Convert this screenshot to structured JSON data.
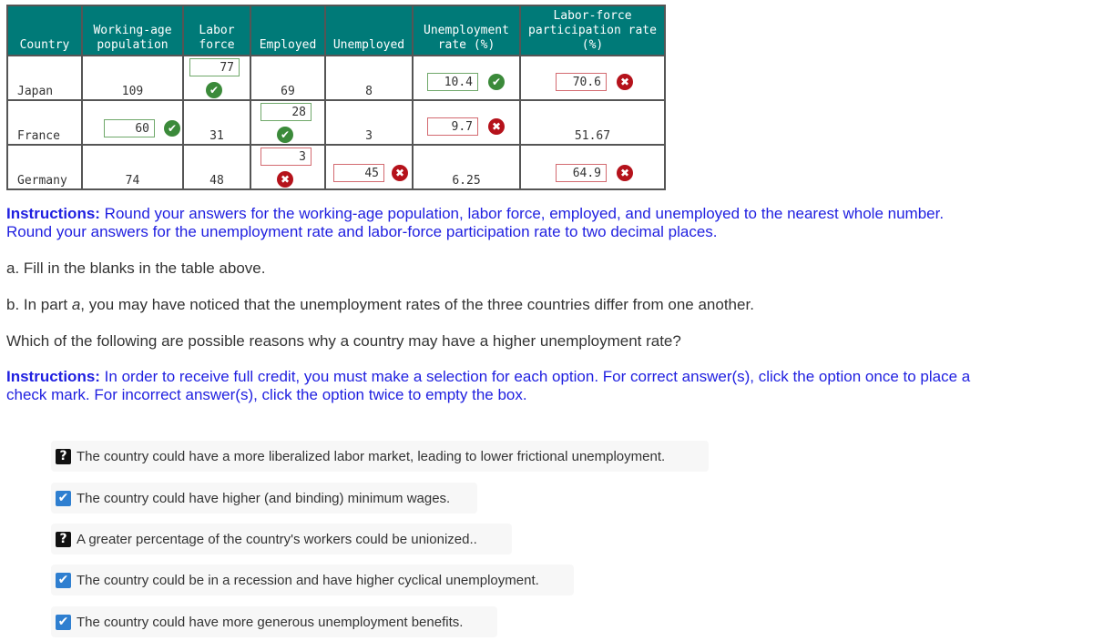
{
  "table": {
    "headers": [
      "Country",
      "Working-age\npopulation",
      "Labor\nforce",
      "Employed",
      "Unemployed",
      "Unemployment\nrate (%)",
      "Labor-force\nparticipation rate\n(%)"
    ],
    "header_lines": {
      "country": [
        "Country"
      ],
      "working_age": [
        "Working-age",
        "population"
      ],
      "labor_force": [
        "Labor",
        "force"
      ],
      "employed": [
        "Employed"
      ],
      "unemployed": [
        "Unemployed"
      ],
      "unemp_rate": [
        "Unemployment",
        "rate (%)"
      ],
      "lfpr": [
        "Labor-force",
        "participation rate",
        "(%)"
      ]
    },
    "rows": [
      {
        "country": "Japan",
        "working_age": {
          "value": "109",
          "type": "static"
        },
        "labor_force": {
          "value": "77",
          "type": "input",
          "status": "correct"
        },
        "employed": {
          "value": "69",
          "type": "static"
        },
        "unemployed": {
          "value": "8",
          "type": "static"
        },
        "unemp_rate": {
          "value": "10.4",
          "type": "input",
          "status": "correct"
        },
        "lfpr": {
          "value": "70.6",
          "type": "input",
          "status": "incorrect"
        }
      },
      {
        "country": "France",
        "working_age": {
          "value": "60",
          "type": "input",
          "status": "correct"
        },
        "labor_force": {
          "value": "31",
          "type": "static"
        },
        "employed": {
          "value": "28",
          "type": "input",
          "status": "correct"
        },
        "unemployed": {
          "value": "3",
          "type": "static"
        },
        "unemp_rate": {
          "value": "9.7",
          "type": "input",
          "status": "incorrect"
        },
        "lfpr": {
          "value": "51.67",
          "type": "static"
        }
      },
      {
        "country": "Germany",
        "working_age": {
          "value": "74",
          "type": "static"
        },
        "labor_force": {
          "value": "48",
          "type": "static"
        },
        "employed": {
          "value": "3",
          "type": "input",
          "status": "incorrect"
        },
        "unemployed": {
          "value": "45",
          "type": "input",
          "status": "incorrect"
        },
        "unemp_rate": {
          "value": "6.25",
          "type": "static"
        },
        "lfpr": {
          "value": "64.9",
          "type": "input",
          "status": "incorrect"
        }
      }
    ]
  },
  "instructions1": {
    "label": "Instructions:",
    "text": " Round your answers for the working-age population, labor force, employed, and unemployed to the nearest whole number. Round your answers for the unemployment rate and labor-force participation rate to two decimal places."
  },
  "part_a": "a. Fill in the blanks in the table above.",
  "part_b": {
    "prefix": "b. In part ",
    "italic": "a",
    "suffix": ", you may have noticed that the unemployment rates of the three countries differ from one another."
  },
  "question": "Which of the following are possible reasons why a country may have a higher unemployment rate?",
  "instructions2": {
    "label": "Instructions:",
    "text": " In order to receive full credit, you must make a selection for each option. For correct answer(s), click the option once to place a check mark. For incorrect answer(s), click the option twice to empty the box."
  },
  "options": [
    {
      "state": "unknown",
      "icon": "?",
      "label": "The country could have a more liberalized labor market, leading to lower frictional unemployment."
    },
    {
      "state": "checked",
      "icon": "✔",
      "label": "The country could have higher (and binding) minimum wages."
    },
    {
      "state": "unknown",
      "icon": "?",
      "label": "A greater percentage of the country's workers could be unionized.."
    },
    {
      "state": "checked",
      "icon": "✔",
      "label": "The country could be in a recession and have higher cyclical unemployment."
    },
    {
      "state": "checked",
      "icon": "✔",
      "label": "The country could have more generous unemployment benefits."
    }
  ],
  "icons": {
    "correct": "✔",
    "incorrect": "✖"
  },
  "colors": {
    "header_bg": "#007a78",
    "correct": "#3b8a3a",
    "incorrect": "#b5121b",
    "instruction_text": "#1f1fe0",
    "checkbox": "#2f7fd0"
  }
}
